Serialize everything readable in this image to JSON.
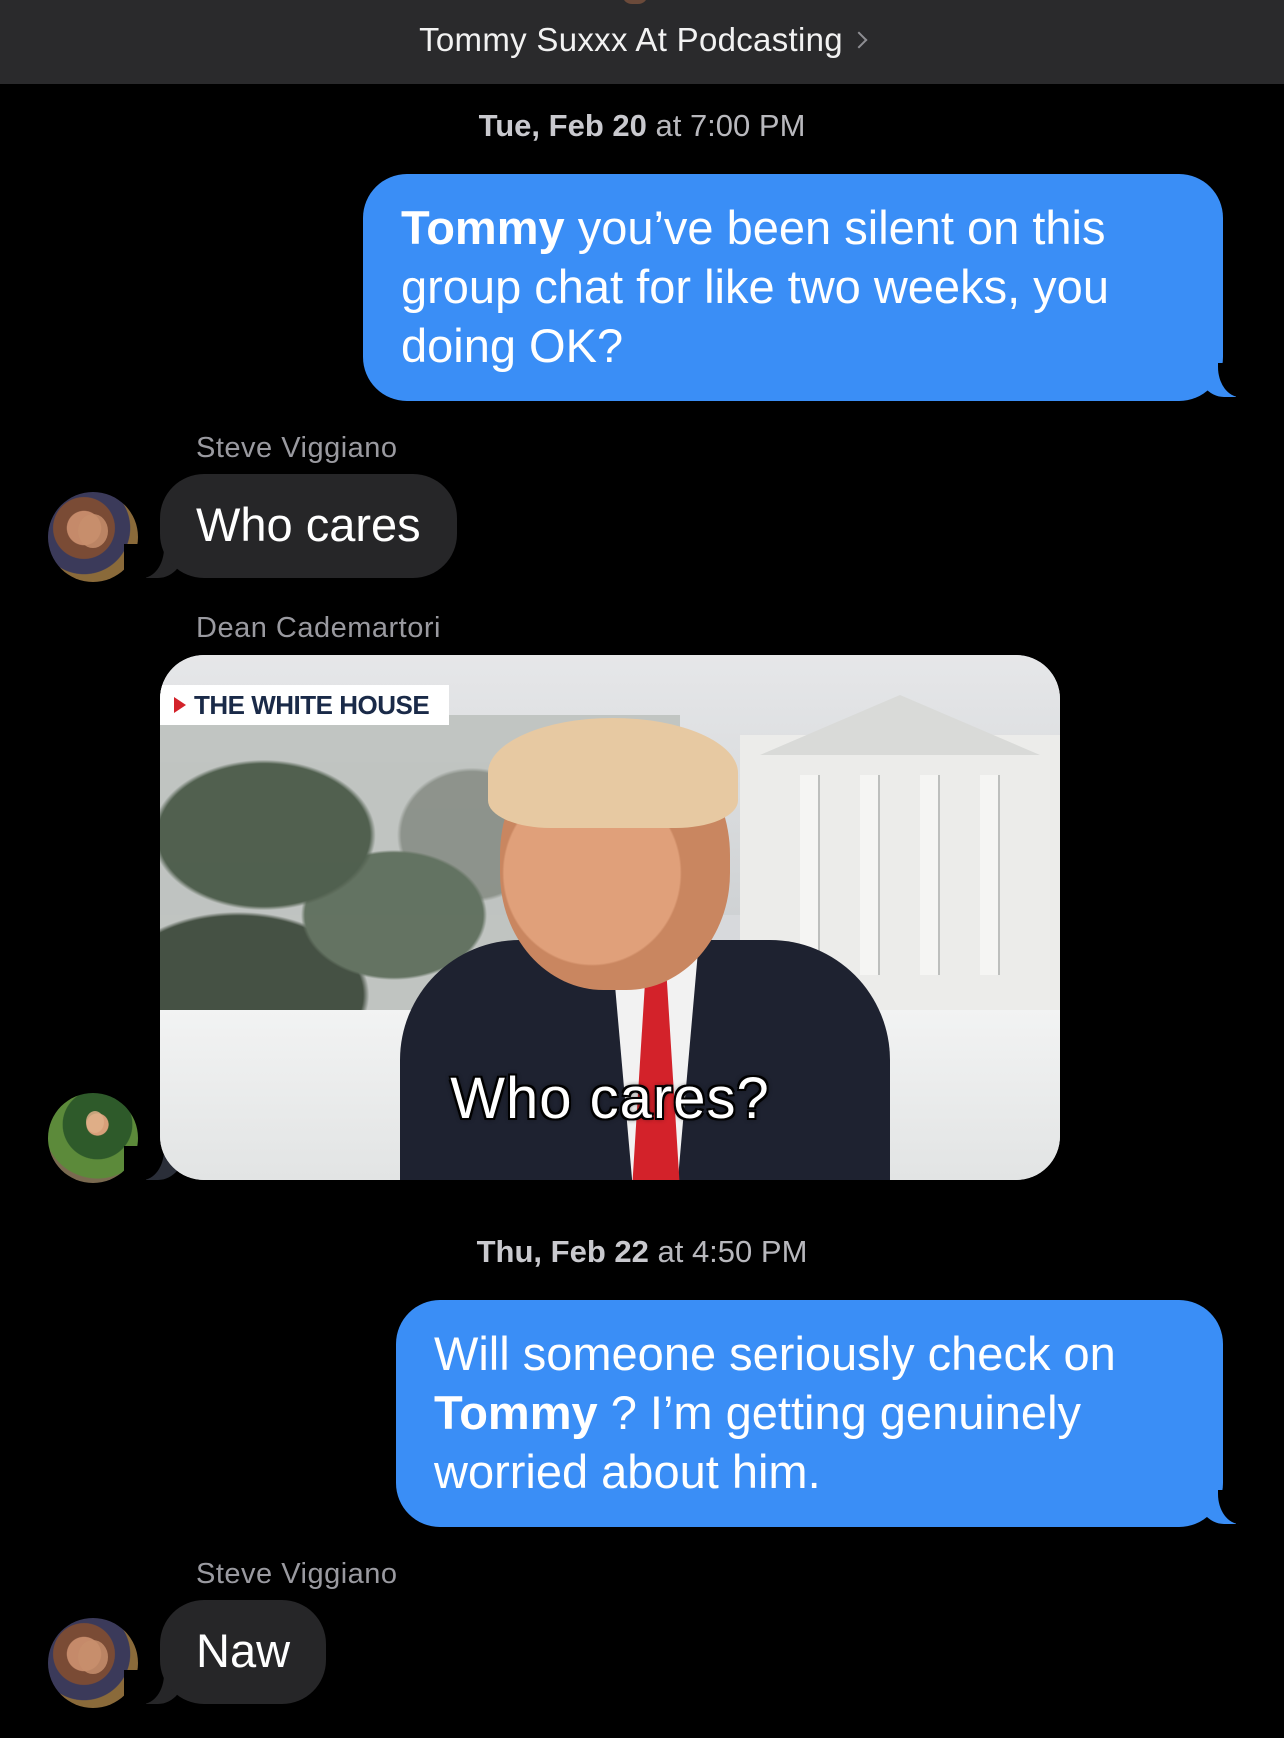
{
  "header": {
    "chat_title": "Tommy Suxxx At Podcasting"
  },
  "timestamps": [
    {
      "day": "Tue, Feb 20",
      "time": " at 7:00 PM"
    },
    {
      "day": "Thu, Feb 22",
      "time": " at 4:50 PM"
    }
  ],
  "messages": [
    {
      "direction": "outgoing",
      "mention": "Tommy",
      "text": " you’ve been silent on this group chat for like two weeks, you doing OK?"
    },
    {
      "direction": "incoming",
      "sender": "Steve Viggiano",
      "text": "Who cares"
    },
    {
      "direction": "incoming",
      "sender": "Dean Cademartori",
      "type": "gif",
      "gif_tag": "THE WHITE HOUSE",
      "gif_caption": "Who cares?"
    },
    {
      "direction": "outgoing",
      "text_before": "Will someone seriously check on ",
      "mention": "Tommy",
      "text_after": " ?  I’m getting genuinely worried about him."
    },
    {
      "direction": "incoming",
      "sender": "Steve Viggiano",
      "text": "Naw"
    }
  ],
  "colors": {
    "outgoing_bubble": "#3a8ef6",
    "incoming_bubble": "#262628",
    "background": "#000000",
    "header": "#2a2a2c"
  }
}
